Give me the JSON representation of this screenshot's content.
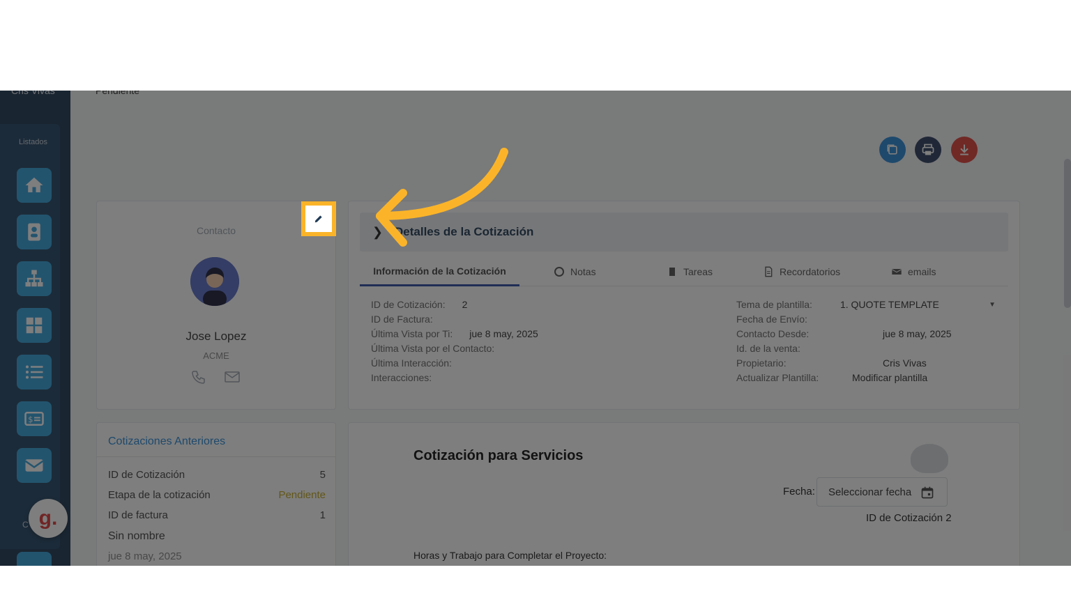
{
  "sidebar": {
    "user_name": "Cris Vivas",
    "section_label": "Listados",
    "items": [
      {
        "name": "home-icon"
      },
      {
        "name": "contacts-icon"
      },
      {
        "name": "org-chart-icon"
      },
      {
        "name": "grid-icon"
      },
      {
        "name": "list-icon"
      },
      {
        "name": "invoice-icon"
      },
      {
        "name": "mail-icon"
      }
    ],
    "chat_letter": "g.",
    "small_label": "C"
  },
  "header": {
    "status_text": "Pendiente",
    "actions": [
      {
        "name": "copy-button",
        "color": "#2b8bd8"
      },
      {
        "name": "print-button",
        "color": "#2f4163"
      },
      {
        "name": "download-button",
        "color": "#e0443a"
      }
    ]
  },
  "contact": {
    "title": "Contacto",
    "name": "Jose Lopez",
    "company": "ACME"
  },
  "details": {
    "title": "Detalles de la Cotización",
    "tabs": [
      "Información de la Cotización",
      "Notas",
      "Tareas",
      "Recordatorios",
      "emails"
    ],
    "left": [
      {
        "label": "ID de Cotización:",
        "value": "2"
      },
      {
        "label": "ID de Factura:",
        "value": ""
      },
      {
        "label": "Última Vista por Ti:",
        "value": "jue 8 may, 2025"
      },
      {
        "label": "Última Vista por el Contacto:",
        "value": ""
      },
      {
        "label": "Última Interacción:",
        "value": ""
      },
      {
        "label": "Interacciones:",
        "value": ""
      }
    ],
    "right": [
      {
        "label": "Tema de plantilla:",
        "value": "1. QUOTE TEMPLATE"
      },
      {
        "label": "Fecha de Envío:",
        "value": ""
      },
      {
        "label": "Contacto Desde:",
        "value": "jue 8 may, 2025"
      },
      {
        "label": "Id. de la venta:",
        "value": ""
      },
      {
        "label": "Propietario:",
        "value": "Cris Vivas"
      },
      {
        "label": "Actualizar Plantilla:",
        "value": "Modificar plantilla"
      }
    ]
  },
  "previous": {
    "title": "Cotizaciones Anteriores",
    "rows": [
      {
        "label": "ID de Cotización",
        "value": "5"
      },
      {
        "label": "Etapa de la cotización",
        "value": "Pendiente"
      },
      {
        "label": "ID de factura",
        "value": "1"
      }
    ],
    "link": "Sin nombre",
    "date": "jue 8 may, 2025"
  },
  "quote": {
    "title": "Cotización para Servicios",
    "date_label": "Fecha:",
    "date_placeholder": "Seleccionar fecha",
    "quote_id_text": "ID de Cotización 2",
    "hours_text": "Horas y Trabajo para Completar el Proyecto:"
  },
  "colors": {
    "highlight": "#fbb429",
    "sidebar": "#1f3a55",
    "sidebar_button": "#36a3dc",
    "link": "#2b8bd8"
  }
}
